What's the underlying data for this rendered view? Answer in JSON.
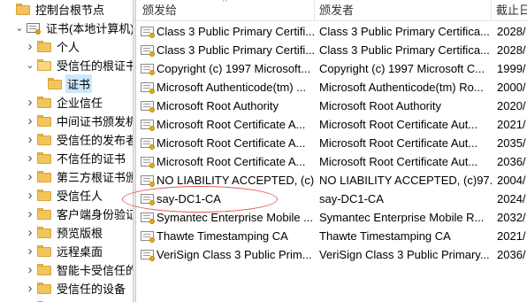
{
  "tree": {
    "items": [
      {
        "label": "控制台根节点",
        "indent": 0,
        "arrow": "",
        "icon": "folder",
        "open": false,
        "selected": false
      },
      {
        "label": "证书(本地计算机)",
        "indent": 1,
        "arrow": "v",
        "icon": "certstore",
        "open": true,
        "selected": false
      },
      {
        "label": "个人",
        "indent": 2,
        "arrow": ">",
        "icon": "folder",
        "open": false,
        "selected": false
      },
      {
        "label": "受信任的根证书颁",
        "indent": 2,
        "arrow": "v",
        "icon": "folder",
        "open": true,
        "selected": false
      },
      {
        "label": "证书",
        "indent": 3,
        "arrow": "",
        "icon": "folder",
        "open": false,
        "selected": true
      },
      {
        "label": "企业信任",
        "indent": 2,
        "arrow": ">",
        "icon": "folder",
        "open": false,
        "selected": false
      },
      {
        "label": "中间证书颁发机",
        "indent": 2,
        "arrow": ">",
        "icon": "folder",
        "open": false,
        "selected": false
      },
      {
        "label": "受信任的发布者",
        "indent": 2,
        "arrow": ">",
        "icon": "folder",
        "open": false,
        "selected": false
      },
      {
        "label": "不信任的证书",
        "indent": 2,
        "arrow": ">",
        "icon": "folder",
        "open": false,
        "selected": false
      },
      {
        "label": "第三方根证书颁",
        "indent": 2,
        "arrow": ">",
        "icon": "folder",
        "open": false,
        "selected": false
      },
      {
        "label": "受信任人",
        "indent": 2,
        "arrow": ">",
        "icon": "folder",
        "open": false,
        "selected": false
      },
      {
        "label": "客户端身份验证",
        "indent": 2,
        "arrow": ">",
        "icon": "folder",
        "open": false,
        "selected": false
      },
      {
        "label": "预览版根",
        "indent": 2,
        "arrow": ">",
        "icon": "folder",
        "open": false,
        "selected": false
      },
      {
        "label": "远程桌面",
        "indent": 2,
        "arrow": ">",
        "icon": "folder",
        "open": false,
        "selected": false
      },
      {
        "label": "智能卡受信任的",
        "indent": 2,
        "arrow": ">",
        "icon": "folder",
        "open": false,
        "selected": false
      },
      {
        "label": "受信任的设备",
        "indent": 2,
        "arrow": ">",
        "icon": "folder",
        "open": false,
        "selected": false
      },
      {
        "label": "Windows Live I",
        "indent": 2,
        "arrow": ">",
        "icon": "folder",
        "open": false,
        "selected": false
      }
    ]
  },
  "list": {
    "columns": {
      "issued_to": "颁发给",
      "issued_by": "颁发者",
      "expiration": "截止日"
    },
    "sort_indicator": "^",
    "rows": [
      {
        "issued_to": "Class 3 Public Primary Certifi...",
        "issued_by": "Class 3 Public Primary Certifica...",
        "expiration": "2028/"
      },
      {
        "issued_to": "Class 3 Public Primary Certifi...",
        "issued_by": "Class 3 Public Primary Certifica...",
        "expiration": "2028/"
      },
      {
        "issued_to": "Copyright (c) 1997 Microsoft...",
        "issued_by": "Copyright (c) 1997 Microsoft C...",
        "expiration": "1999/"
      },
      {
        "issued_to": "Microsoft Authenticode(tm) ...",
        "issued_by": "Microsoft Authenticode(tm) Ro...",
        "expiration": "2000/"
      },
      {
        "issued_to": "Microsoft Root Authority",
        "issued_by": "Microsoft Root Authority",
        "expiration": "2020/"
      },
      {
        "issued_to": "Microsoft Root Certificate A...",
        "issued_by": "Microsoft Root Certificate Aut...",
        "expiration": "2021/"
      },
      {
        "issued_to": "Microsoft Root Certificate A...",
        "issued_by": "Microsoft Root Certificate Aut...",
        "expiration": "2035/"
      },
      {
        "issued_to": "Microsoft Root Certificate A...",
        "issued_by": "Microsoft Root Certificate Aut...",
        "expiration": "2036/"
      },
      {
        "issued_to": "NO LIABILITY ACCEPTED, (c)...",
        "issued_by": "NO LIABILITY ACCEPTED, (c)97...",
        "expiration": "2004/"
      },
      {
        "issued_to": "say-DC1-CA",
        "issued_by": "say-DC1-CA",
        "expiration": "2024/"
      },
      {
        "issued_to": "Symantec Enterprise Mobile ...",
        "issued_by": "Symantec Enterprise Mobile R...",
        "expiration": "2032/"
      },
      {
        "issued_to": "Thawte Timestamping CA",
        "issued_by": "Thawte Timestamping CA",
        "expiration": "2021/"
      },
      {
        "issued_to": "VeriSign Class 3 Public Prim...",
        "issued_by": "VeriSign Class 3 Public Primary...",
        "expiration": "2036/"
      }
    ]
  },
  "colors": {
    "selection": "#cce8ff",
    "annotation": "#e05a5a",
    "folder": "#f2c55c"
  }
}
